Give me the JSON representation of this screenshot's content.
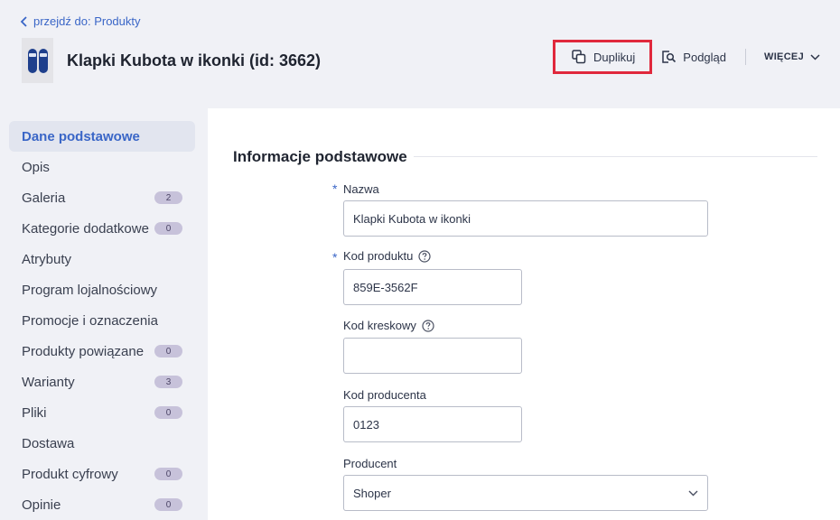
{
  "header": {
    "back_label": "przejdź do: Produkty",
    "title": "Klapki Kubota w ikonki (id: 3662)",
    "actions": {
      "duplicate": "Duplikuj",
      "preview": "Podgląd",
      "more": "WIĘCEJ"
    }
  },
  "sidebar": {
    "items": [
      {
        "label": "Dane podstawowe",
        "badge": null
      },
      {
        "label": "Opis",
        "badge": null
      },
      {
        "label": "Galeria",
        "badge": "2"
      },
      {
        "label": "Kategorie dodatkowe",
        "badge": "0"
      },
      {
        "label": "Atrybuty",
        "badge": null
      },
      {
        "label": "Program lojalnościowy",
        "badge": null
      },
      {
        "label": "Promocje i oznaczenia",
        "badge": null
      },
      {
        "label": "Produkty powiązane",
        "badge": "0"
      },
      {
        "label": "Warianty",
        "badge": "3"
      },
      {
        "label": "Pliki",
        "badge": "0"
      },
      {
        "label": "Dostawa",
        "badge": null
      },
      {
        "label": "Produkt cyfrowy",
        "badge": "0"
      },
      {
        "label": "Opinie",
        "badge": "0"
      }
    ]
  },
  "form": {
    "section_title": "Informacje podstawowe",
    "required_mark": "*",
    "name": {
      "label": "Nazwa",
      "value": "Klapki Kubota w ikonki"
    },
    "product_code": {
      "label": "Kod produktu",
      "value": "859E-3562F"
    },
    "barcode": {
      "label": "Kod kreskowy",
      "value": ""
    },
    "producer_code": {
      "label": "Kod producenta",
      "value": "0123"
    },
    "producer": {
      "label": "Producent",
      "value": "Shoper"
    }
  },
  "colors": {
    "accent": "#3a66c7",
    "highlight_border": "#e0283c",
    "badge_bg": "#c7c2da"
  }
}
